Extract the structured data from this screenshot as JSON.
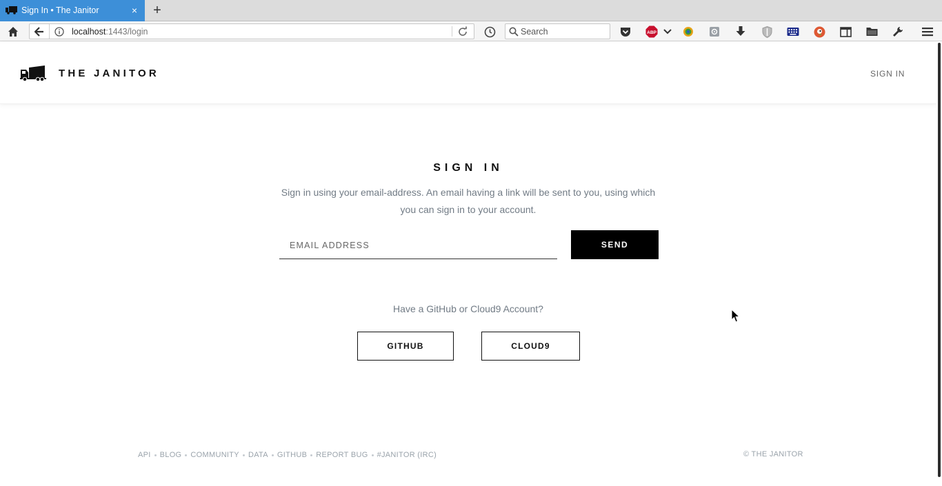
{
  "browser": {
    "tab_title": "Sign In • The Janitor",
    "tab_close": "×",
    "new_tab": "+",
    "url_host": "localhost",
    "url_rest": ":1443/login",
    "search_placeholder": "Search"
  },
  "header": {
    "logo_text": "THE JANITOR",
    "signin_link": "SIGN IN"
  },
  "main": {
    "title": "SIGN IN",
    "description": "Sign in using your email-address. An email having a link will be sent to you, using which you can sign in to your account.",
    "email_placeholder": "EMAIL ADDRESS",
    "send_label": "SEND",
    "alt_prompt": "Have a GitHub or Cloud9 Account?",
    "github_label": "GITHUB",
    "cloud9_label": "CLOUD9"
  },
  "footer": {
    "links": [
      "API",
      "BLOG",
      "COMMUNITY",
      "DATA",
      "GITHUB",
      "REPORT BUG",
      "#JANITOR (IRC)"
    ],
    "copyright": "© THE JANITOR"
  },
  "colors": {
    "tab_active": "#3d8fd8",
    "send_bg": "#000000",
    "muted_text": "#717b85",
    "footer_text": "#9aa3ab"
  },
  "icons": {
    "toolbar": [
      "home-icon",
      "back-icon",
      "info-icon",
      "reload-icon",
      "history-icon",
      "search-icon",
      "pocket-icon",
      "adblock-icon",
      "dropdown-icon",
      "extension-icon",
      "settings-icon",
      "download-icon",
      "shield-icon",
      "keyboard-icon",
      "duckduckgo-icon",
      "sidebar-icon",
      "folder-icon",
      "wrench-icon",
      "menu-icon"
    ]
  }
}
